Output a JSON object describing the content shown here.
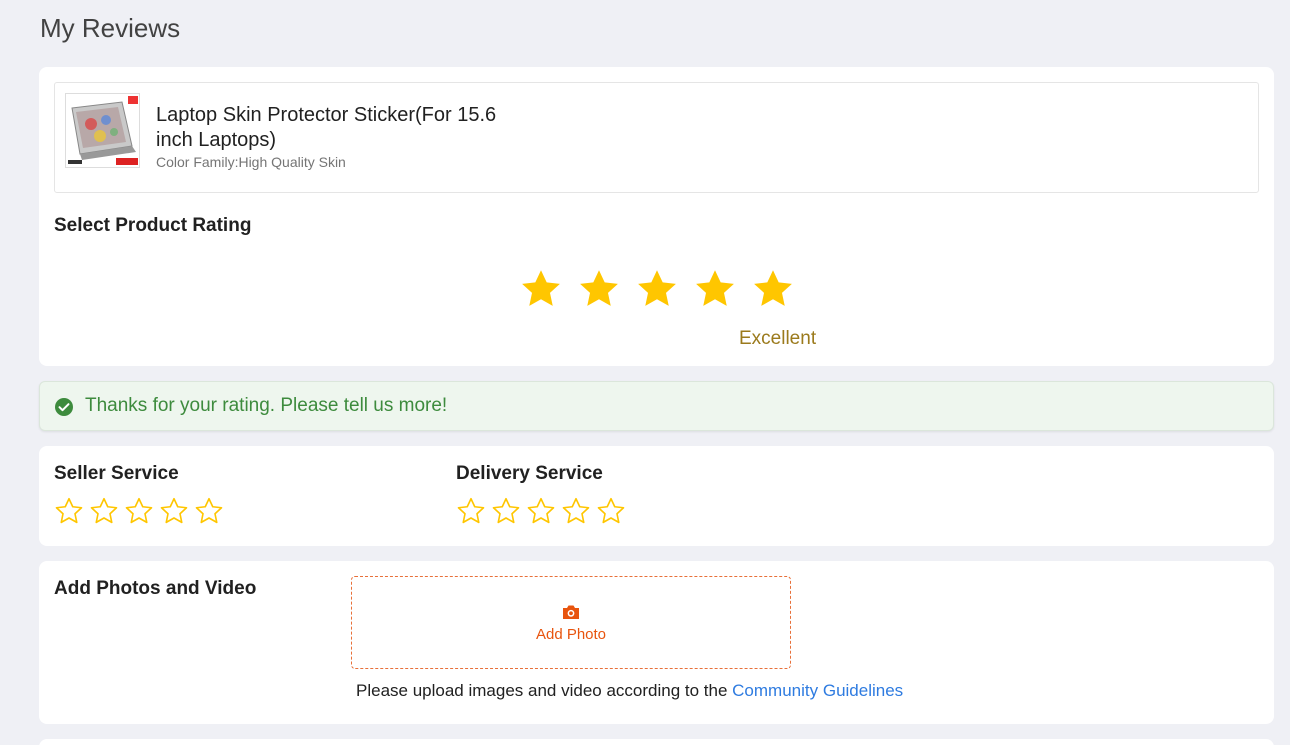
{
  "page": {
    "title": "My Reviews"
  },
  "product": {
    "name": "Laptop Skin Protector Sticker(For 15.6 inch Laptops)",
    "variant": "Color Family:High Quality Skin"
  },
  "product_rating": {
    "label": "Select Product Rating",
    "value": 5,
    "max": 5,
    "text": "Excellent",
    "star_color": "#ffc600"
  },
  "notice": {
    "text": "Thanks for your rating. Please tell us more!",
    "icon": "check-circle-icon",
    "color": "#3d8b3d"
  },
  "seller_service": {
    "label": "Seller Service",
    "value": 0,
    "max": 5
  },
  "delivery_service": {
    "label": "Delivery Service",
    "value": 0,
    "max": 5
  },
  "media": {
    "label": "Add Photos and Video",
    "add_photo_label": "Add Photo",
    "icon": "camera-icon",
    "guideline_text": "Please upload images and video according to the ",
    "guideline_link": "Community Guidelines",
    "accent": "#e8540e"
  }
}
